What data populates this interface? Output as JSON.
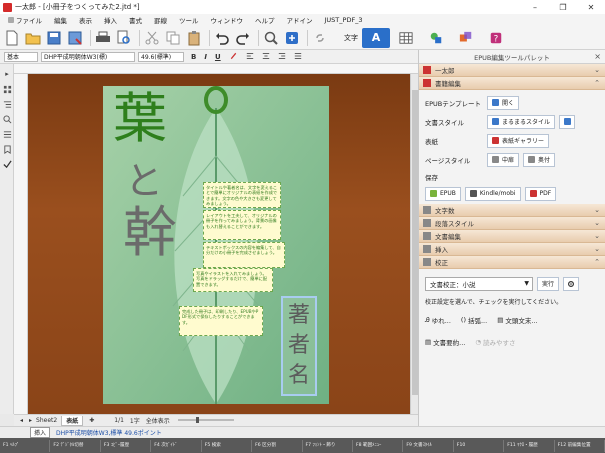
{
  "window": {
    "title": "一太郎 - [小冊子をつくってみた2.jtd *]",
    "controls": [
      "–",
      "❐",
      "✕"
    ]
  },
  "menu": [
    {
      "label": "ファイル"
    },
    {
      "label": "編集"
    },
    {
      "label": "表示"
    },
    {
      "label": "挿入"
    },
    {
      "label": "書式"
    },
    {
      "label": "罫線"
    },
    {
      "label": "ツール"
    },
    {
      "label": "ウィンドウ"
    },
    {
      "label": "ヘルプ"
    },
    {
      "label": "アドイン"
    },
    {
      "label": "JUST_PDF_3"
    }
  ],
  "toolbar": {
    "text_label": "文字",
    "mode_a": "A"
  },
  "format": {
    "style_name": "基本",
    "font_name": "DHP平成明朝体W3(標)",
    "font_size": "49.6(標準)",
    "bold": "B",
    "italic": "I",
    "underline": "U"
  },
  "cover": {
    "title_line1": "葉",
    "title_line2": "と",
    "title_line3": "幹",
    "author": [
      "著",
      "者",
      "名"
    ],
    "text_blocks": [
      "タイトルや著者名は、文字を変えることで簡単にオリジナルの表紙を作成できます。文字の色や大きさも変更してみましょう。",
      "レイアウトを工夫して、オリジナルの冊子を作ってみましょう。背景の画像も入れ替えることができます。",
      "テキストボックスの内容を編集して、自分だけの小冊子を完成させましょう。",
      "写真やイラストを入れてみましょう。写真をドラッグするだけで、簡単に配置できます。",
      "完成した冊子は、印刷したり、EPUBやPDF形式で保存したりすることができます。"
    ]
  },
  "sheets": {
    "tabs": [
      "Sheet2",
      "表紙"
    ],
    "active": 1,
    "page_info": "1/1",
    "chars": "1字",
    "view": "全体表示"
  },
  "inputbar": {
    "mode": "挿入",
    "font_info": "DHP平成明朝体W3,標準  49.6ポイント"
  },
  "fkeys": [
    "F1 ﾍﾙﾌﾟ",
    "F2 ﾃﾞｼﾞﾀﾙ切替",
    "F3 ｺﾋﾟｰ履歴",
    "F4 次ｶﾞｲﾄﾞ",
    "F5 検索",
    "F6 区分割",
    "F7 ﾌｫﾝﾄ・飾り",
    "F8 範囲ﾒﾆｭｰ",
    "F9 文書ｽﾀｲﾙ",
    "F10 ",
    "F11 ﾏｸﾛ・履歴",
    "F12 前編集位置"
  ],
  "panel": {
    "title": "EPUB編集ツールパレット",
    "sections": {
      "taichi": "一太郎",
      "book_edit": "書籍編集",
      "char_count": "文字数",
      "para_style": "段落スタイル",
      "doc_edit": "文書編集",
      "insert": "挿入",
      "proofread": "校正"
    },
    "book": {
      "epub_template_label": "EPUBテンプレート",
      "open_button": "開く",
      "doc_style_label": "文書スタイル",
      "marumaru_button": "まるまるスタイル",
      "cover_label": "表紙",
      "cover_gallery_button": "表紙ギャラリー",
      "page_style_label": "ページスタイル",
      "middle_button": "中扉",
      "colophon_button": "奥付",
      "save_label": "保存",
      "save_epub": "EPUB",
      "save_kindle": "Kindle/mobi",
      "save_pdf": "PDF"
    },
    "proof": {
      "select_value": "文書校正：小説",
      "run_button": "実行",
      "hint": "校正設定を選んで、チェックを実行してください。",
      "tool_yure": "ゆれ...",
      "tool_kakko": "括弧...",
      "tool_bunmatsu": "文頭文末...",
      "tool_summary": "文書要約...",
      "tool_readability": "読みやすさ"
    }
  }
}
